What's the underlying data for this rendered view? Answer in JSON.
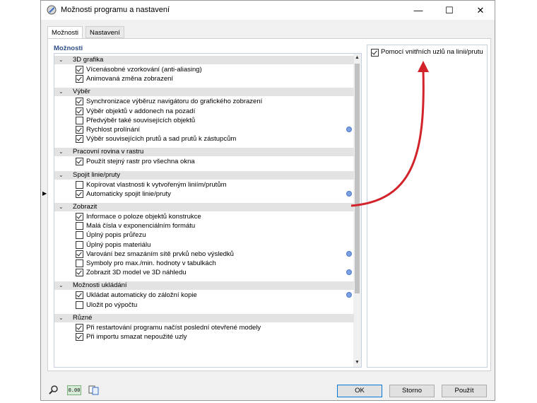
{
  "window": {
    "title": "Možnosti programu a nastavení",
    "minimize": "—",
    "maximize": "☐",
    "close": "✕"
  },
  "tabs": [
    "Možnosti",
    "Nastavení"
  ],
  "section_title": "Možnosti",
  "groups": [
    {
      "label": "3D grafika",
      "items": [
        {
          "label": "Vícenásobné vzorkování (anti-aliasing)",
          "checked": true
        },
        {
          "label": "Animovaná změna zobrazení",
          "checked": true
        }
      ]
    },
    {
      "label": "Výběr",
      "items": [
        {
          "label": "Synchronizace výběruz navigátoru do grafického zobrazení",
          "checked": true
        },
        {
          "label": "Výběr objektů v addonech na pozadí",
          "checked": true
        },
        {
          "label": "Předvýběr také souvisejících objektů",
          "checked": false
        },
        {
          "label": "Rychlost prolínání",
          "checked": true,
          "info": true
        },
        {
          "label": "Výběr souvisejících prutů a sad prutů k zástupcům",
          "checked": true
        }
      ]
    },
    {
      "label": "Pracovní rovina v rastru",
      "items": [
        {
          "label": "Použít stejný rastr pro všechna okna",
          "checked": true
        }
      ]
    },
    {
      "label": "Spojit linie/pruty",
      "items": [
        {
          "label": "Kopírovat vlastnosti k vytvořeným liniím/prutům",
          "checked": false
        },
        {
          "label": "Automaticky spojit linie/pruty",
          "checked": true,
          "info": true,
          "pointer": true
        }
      ]
    },
    {
      "label": "Zobrazit",
      "items": [
        {
          "label": "Informace o poloze objektů konstrukce",
          "checked": true
        },
        {
          "label": "Malá čísla v exponenciálním formátu",
          "checked": false
        },
        {
          "label": "Úplný popis průřezu",
          "checked": false
        },
        {
          "label": "Úplný popis materiálu",
          "checked": false
        },
        {
          "label": "Varování bez smazáním sítě prvků nebo výsledků",
          "checked": true,
          "info": true
        },
        {
          "label": "Symboly pro max./min. hodnoty v tabulkách",
          "checked": false
        },
        {
          "label": "Zobrazit 3D model ve 3D náhledu",
          "checked": true,
          "info": true
        }
      ]
    },
    {
      "label": "Možnosti ukládání",
      "items": [
        {
          "label": "Ukládat automaticky do záložní kopie",
          "checked": true,
          "info": true
        },
        {
          "label": "Uložit po výpočtu",
          "checked": false
        }
      ]
    },
    {
      "label": "Různé",
      "items": [
        {
          "label": "Při restartování programu načíst poslední otevřené modely",
          "checked": true
        },
        {
          "label": "Při importu smazat nepoužité uzly",
          "checked": true
        }
      ]
    }
  ],
  "right_panel": {
    "label": "Pomocí vnitřních uzlů na linii/prutu",
    "checked": true
  },
  "footer_icons": [
    "search-icon",
    "decimal-icon",
    "copy-icon"
  ],
  "decimal_icon_text": "0.00",
  "buttons": {
    "ok": "OK",
    "cancel": "Storno",
    "apply": "Použít"
  },
  "colors": {
    "accent": "#2e4f8a",
    "arrow": "#d2232a",
    "info": "#7aa2e3"
  }
}
